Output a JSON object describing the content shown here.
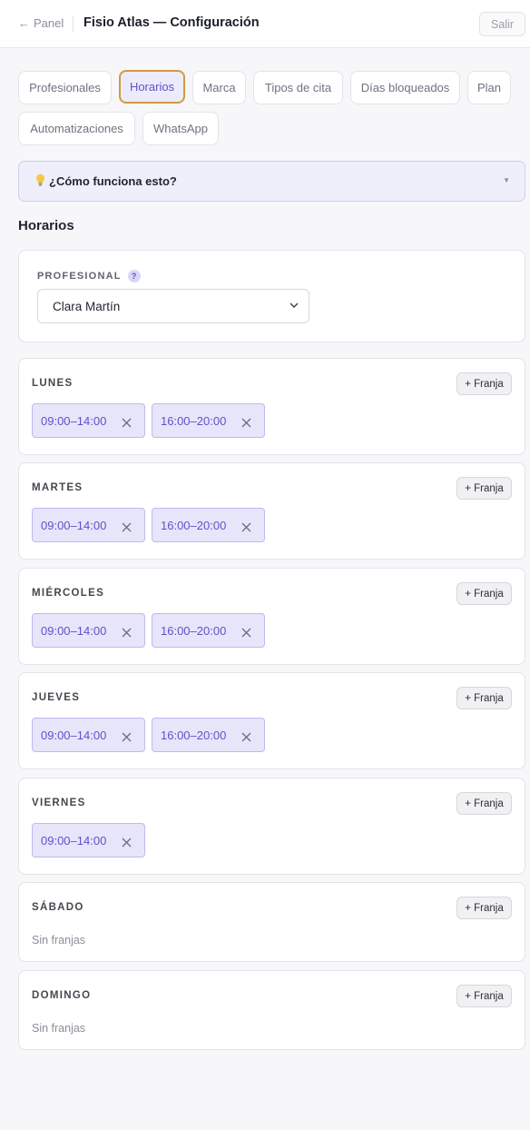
{
  "header": {
    "back_label": "Panel",
    "title": "Fisio Atlas — Configuración",
    "logout_label": "Salir"
  },
  "tabs": [
    {
      "label": "Profesionales",
      "active": false
    },
    {
      "label": "Horarios",
      "active": true
    },
    {
      "label": "Marca",
      "active": false
    },
    {
      "label": "Tipos de cita",
      "active": false
    },
    {
      "label": "Días bloqueados",
      "active": false
    },
    {
      "label": "Plan",
      "active": false
    },
    {
      "label": "Automatizaciones",
      "active": false
    },
    {
      "label": "WhatsApp",
      "active": false
    }
  ],
  "info": {
    "label": "¿Cómo funciona esto?",
    "icon": "lightbulb-icon"
  },
  "section_title": "Horarios",
  "professional": {
    "label": "PROFESIONAL",
    "help": "?",
    "selected": "Clara Martín"
  },
  "add_slot_label": "+ Franja",
  "empty_label": "Sin franjas",
  "days": [
    {
      "name": "LUNES",
      "slots": [
        "09:00–14:00",
        "16:00–20:00"
      ]
    },
    {
      "name": "MARTES",
      "slots": [
        "09:00–14:00",
        "16:00–20:00"
      ]
    },
    {
      "name": "MIÉRCOLES",
      "slots": [
        "09:00–14:00",
        "16:00–20:00"
      ]
    },
    {
      "name": "JUEVES",
      "slots": [
        "09:00–14:00",
        "16:00–20:00"
      ]
    },
    {
      "name": "VIERNES",
      "slots": [
        "09:00–14:00"
      ]
    },
    {
      "name": "SÁBADO",
      "slots": []
    },
    {
      "name": "DOMINGO",
      "slots": []
    }
  ],
  "colors": {
    "accent": "#5b54c9",
    "active_tab_border": "#d39a3e",
    "slot_bg": "#e6e5fa"
  }
}
